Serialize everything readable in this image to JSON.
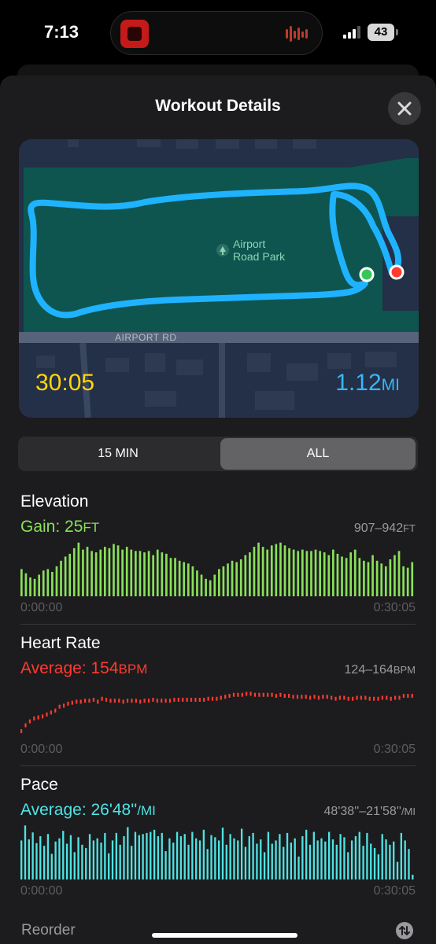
{
  "status_bar": {
    "time": "7:13",
    "battery": "43",
    "signal_icon": "cellular-signal-icon",
    "now_playing_icon": "waveform-icon"
  },
  "sheet": {
    "title": "Workout Details",
    "close_icon": "close-icon"
  },
  "map": {
    "park_label_line1": "Airport",
    "park_label_line2": "Road Park",
    "road_label": "AIRPORT RD",
    "duration": "30:05",
    "distance_value": "1.12",
    "distance_unit": "MI",
    "route_color": "#1fb3ff",
    "start_marker_color": "#34c759",
    "end_marker_color": "#ff3b30"
  },
  "segmented_control": {
    "options": [
      "15 MIN",
      "ALL"
    ],
    "selected": "ALL"
  },
  "elevation": {
    "title": "Elevation",
    "summary_label": "Gain: 25",
    "summary_unit": "FT",
    "range_label": "907–942",
    "range_unit": "FT",
    "start_time": "0:00:00",
    "end_time": "0:30:05",
    "color": "#8ae05a"
  },
  "heart_rate": {
    "title": "Heart Rate",
    "summary_label": "Average: 154",
    "summary_unit": "BPM",
    "range_label": "124–164",
    "range_unit": "BPM",
    "start_time": "0:00:00",
    "end_time": "0:30:05",
    "color": "#ff3b30"
  },
  "pace": {
    "title": "Pace",
    "summary_label": "Average: 26'48''",
    "summary_unit": "/MI",
    "range_label": "48'38''–21'58''",
    "range_unit": "/MI",
    "start_time": "0:00:00",
    "end_time": "0:30:05",
    "color": "#4fe3e3"
  },
  "footer": {
    "reorder_label": "Reorder",
    "reorder_icon": "reorder-arrows-icon"
  },
  "chart_data": [
    {
      "type": "bar",
      "title": "Elevation",
      "x_range": [
        "0:00:00",
        "0:30:05"
      ],
      "ylim": [
        907,
        942
      ],
      "unit": "FT",
      "values": [
        922,
        919,
        916,
        915,
        918,
        921,
        922,
        920,
        924,
        928,
        931,
        933,
        937,
        941,
        936,
        938,
        935,
        934,
        936,
        938,
        937,
        940,
        939,
        936,
        938,
        936,
        935,
        935,
        934,
        935,
        932,
        936,
        934,
        933,
        930,
        930,
        928,
        927,
        926,
        924,
        921,
        918,
        915,
        914,
        918,
        922,
        924,
        926,
        928,
        927,
        929,
        932,
        934,
        938,
        941,
        938,
        936,
        939,
        940,
        941,
        939,
        937,
        936,
        935,
        936,
        935,
        935,
        936,
        935,
        934,
        932,
        936,
        933,
        931,
        930,
        934,
        936,
        930,
        928,
        927,
        932,
        928,
        926,
        924,
        929,
        932,
        935,
        924,
        923,
        927
      ]
    },
    {
      "type": "scatter",
      "title": "Heart Rate",
      "x_range": [
        "0:00:00",
        "0:30:05"
      ],
      "ylim": [
        124,
        164
      ],
      "unit": "BPM",
      "values": [
        124,
        130,
        134,
        137,
        138,
        139,
        141,
        143,
        145,
        149,
        150,
        152,
        153,
        154,
        154,
        155,
        155,
        156,
        154,
        157,
        156,
        155,
        155,
        155,
        154,
        155,
        155,
        155,
        154,
        155,
        155,
        156,
        155,
        155,
        155,
        155,
        156,
        156,
        156,
        156,
        156,
        156,
        156,
        156,
        157,
        157,
        157,
        158,
        159,
        160,
        161,
        161,
        161,
        162,
        162,
        161,
        161,
        161,
        161,
        161,
        160,
        161,
        160,
        160,
        159,
        159,
        159,
        159,
        158,
        159,
        158,
        159,
        159,
        158,
        157,
        158,
        158,
        157,
        157,
        158,
        158,
        158,
        157,
        157,
        157,
        158,
        158,
        157,
        158,
        158,
        160,
        160,
        160
      ]
    },
    {
      "type": "bar",
      "title": "Pace",
      "x_range": [
        "0:00:00",
        "0:30:05"
      ],
      "range_label": "48'38''–21'58''",
      "unit": "/MI",
      "values": [
        0.7,
        0.98,
        0.72,
        0.85,
        0.65,
        0.78,
        0.6,
        0.82,
        0.45,
        0.68,
        0.74,
        0.88,
        0.64,
        0.8,
        0.48,
        0.76,
        0.62,
        0.56,
        0.82,
        0.7,
        0.74,
        0.66,
        0.84,
        0.46,
        0.7,
        0.84,
        0.62,
        0.78,
        0.95,
        0.6,
        0.86,
        0.8,
        0.82,
        0.84,
        0.86,
        0.9,
        0.78,
        0.84,
        0.5,
        0.74,
        0.66,
        0.86,
        0.78,
        0.82,
        0.62,
        0.86,
        0.74,
        0.7,
        0.9,
        0.54,
        0.8,
        0.76,
        0.7,
        0.94,
        0.62,
        0.82,
        0.74,
        0.7,
        0.92,
        0.58,
        0.78,
        0.84,
        0.64,
        0.72,
        0.48,
        0.86,
        0.64,
        0.7,
        0.82,
        0.58,
        0.84,
        0.66,
        0.74,
        0.4,
        0.78,
        0.9,
        0.62,
        0.86,
        0.7,
        0.74,
        0.68,
        0.86,
        0.72,
        0.62,
        0.82,
        0.76,
        0.48,
        0.7,
        0.78,
        0.86,
        0.6,
        0.84,
        0.64,
        0.56,
        0.44,
        0.82,
        0.72,
        0.62,
        0.68,
        0.3,
        0.84,
        0.7,
        0.54,
        0.06
      ]
    }
  ]
}
